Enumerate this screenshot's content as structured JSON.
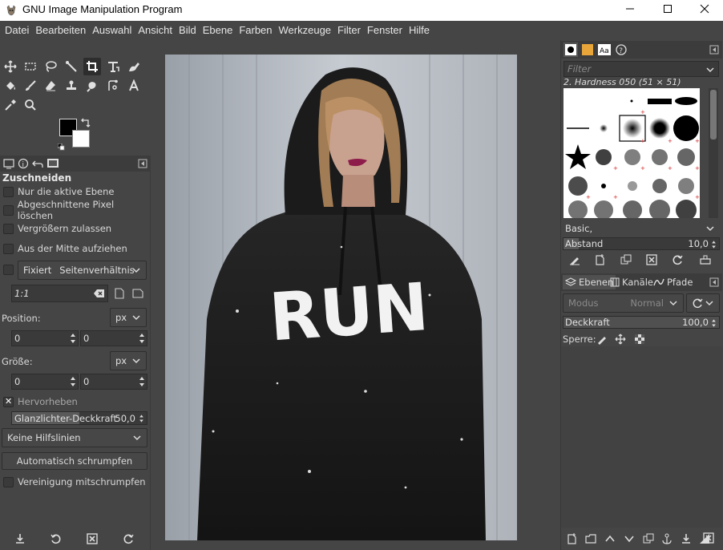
{
  "window": {
    "title": "GNU Image Manipulation Program",
    "minimize_icon": "minimize-icon",
    "maximize_icon": "maximize-icon",
    "close_icon": "close-icon"
  },
  "menu": [
    "Datei",
    "Bearbeiten",
    "Auswahl",
    "Ansicht",
    "Bild",
    "Ebene",
    "Farben",
    "Werkzeuge",
    "Filter",
    "Fenster",
    "Hilfe"
  ],
  "tool_options": {
    "heading": "Zuschneiden",
    "only_active_layer": "Nur die aktive Ebene",
    "delete_cropped_pixels": "Abgeschnittene Pixel löschen",
    "allow_growing": "Vergrößern zulassen",
    "expand_from_center": "Aus der Mitte aufziehen",
    "fixed_label": "Fixiert",
    "fixed_mode": "Seitenverhältnis",
    "ratio_value": "1:1",
    "position_label": "Position:",
    "position_unit": "px",
    "position_x": "0",
    "position_y": "0",
    "size_label": "Größe:",
    "size_unit": "px",
    "size_w": "0",
    "size_h": "0",
    "highlight_label": "Hervorheben",
    "highlight_on": true,
    "highlight_opacity_label": "Glanzlichter-Deckkraft",
    "highlight_opacity_value": "50,0",
    "guides": "Keine Hilfslinien",
    "auto_shrink": "Automatisch schrumpfen",
    "shrink_merged": "Vereinigung mitschrumpfen"
  },
  "image": {
    "shirt_text": "RUN"
  },
  "brushes": {
    "filter_placeholder": "Filter",
    "selected_brush": "2. Hardness 050 (51 × 51)",
    "preset": "Basic,",
    "spacing_label": "Abstand",
    "spacing_value": "10,0"
  },
  "layers": {
    "tabs": [
      "Ebenen",
      "Kanäle",
      "Pfade"
    ],
    "mode_label": "Modus",
    "mode_value": "Normal",
    "opacity_label": "Deckkraft",
    "opacity_value": "100,0",
    "lock_label": "Sperre:"
  },
  "colors": {
    "background": "#454545",
    "panel_dark": "#3a3a3a",
    "fg": "#000000",
    "bg": "#ffffff"
  }
}
